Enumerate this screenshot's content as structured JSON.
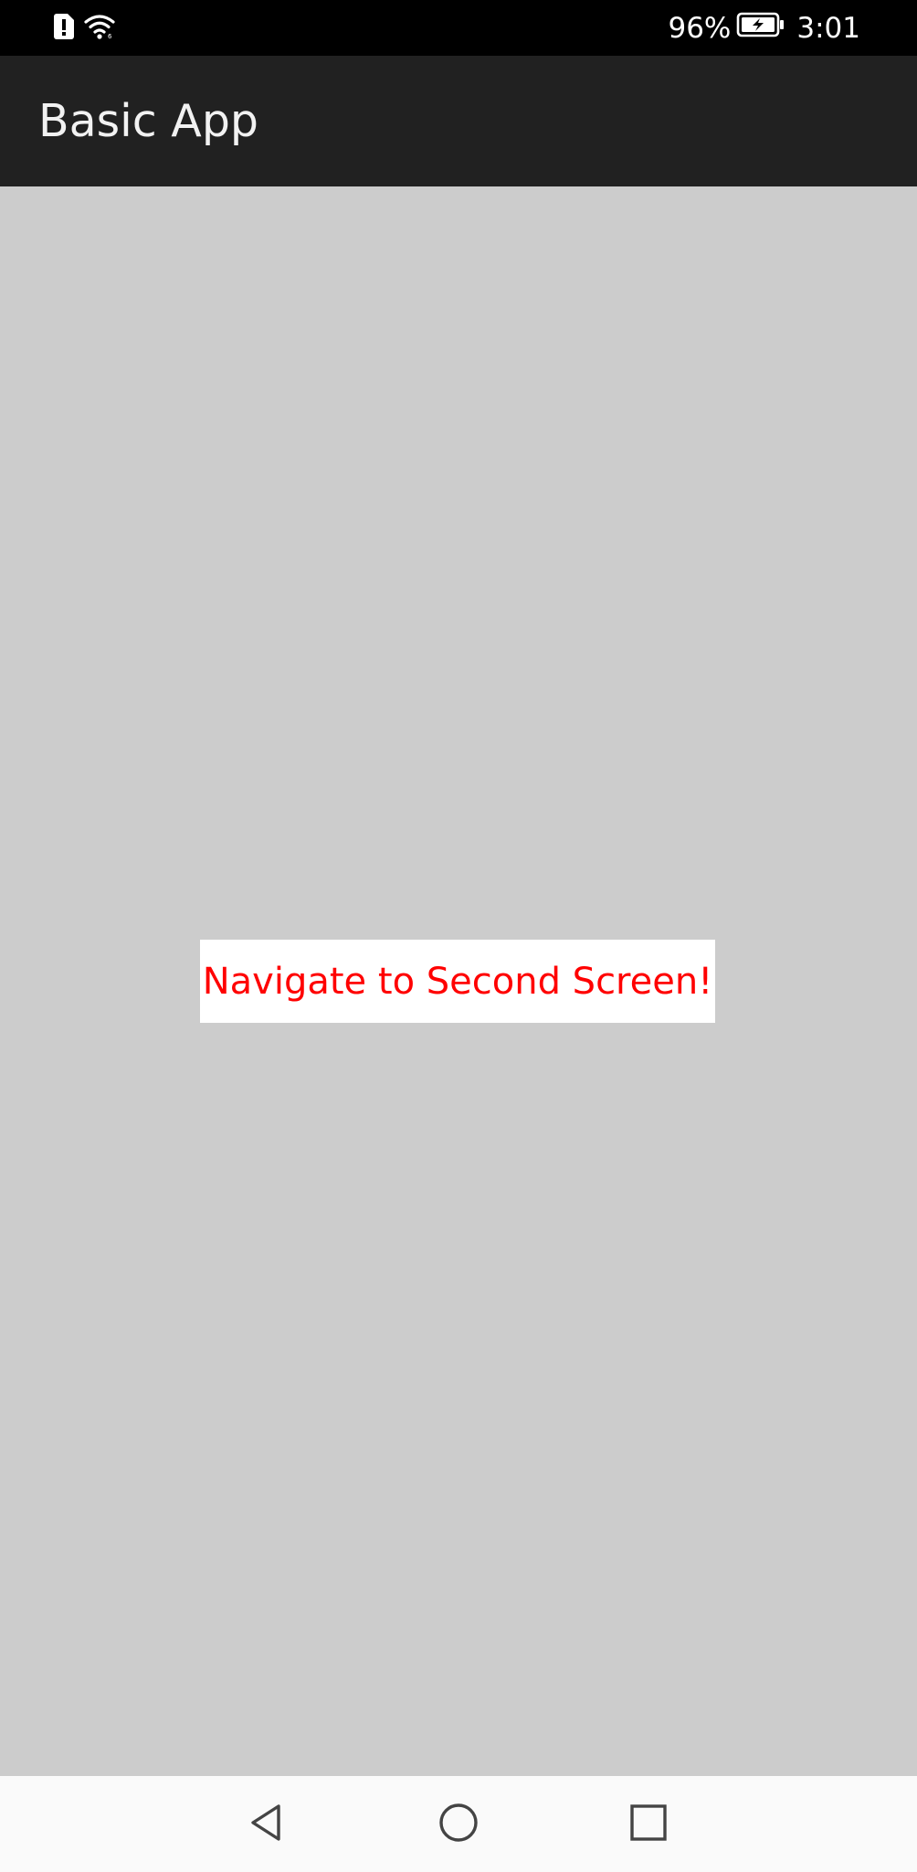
{
  "status_bar": {
    "battery_percent": "96%",
    "time": "3:01",
    "icons": [
      "sim-alert-icon",
      "wifi-icon",
      "battery-charging-icon"
    ]
  },
  "app_bar": {
    "title": "Basic App"
  },
  "main": {
    "navigate_button_label": "Navigate to Second Screen!"
  },
  "nav_bar": {
    "icons": [
      "back-icon",
      "home-icon",
      "recents-icon"
    ]
  },
  "colors": {
    "status_bar_bg": "#000000",
    "app_bar_bg": "#212121",
    "content_bg": "#cccccc",
    "button_bg": "#ffffff",
    "button_text": "#ff0000",
    "nav_bar_bg": "#fafafa"
  }
}
